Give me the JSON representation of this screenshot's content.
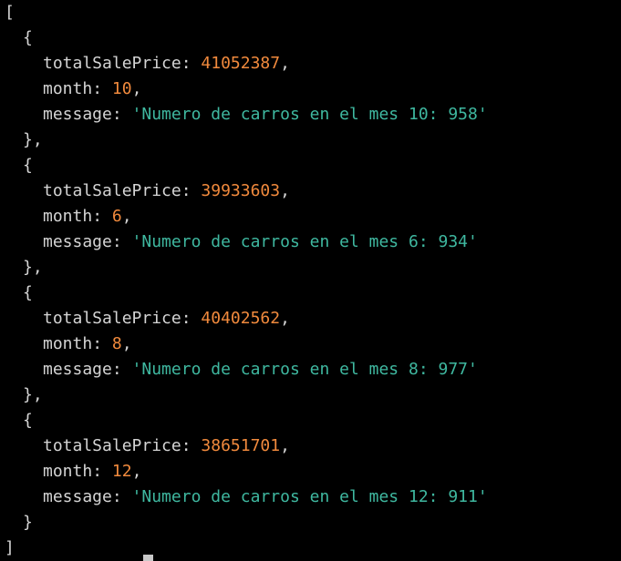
{
  "terminal": {
    "open_bracket": "[",
    "close_bracket": "]",
    "open_brace": "{",
    "close_brace_comma": "},",
    "close_brace": "}",
    "key_total": "totalSalePrice",
    "key_month": "month",
    "key_message": "message",
    "colon": ": ",
    "comma": ",",
    "entries": [
      {
        "totalSalePrice": "41052387",
        "month": "10",
        "message": "'Numero de carros en el mes 10: 958'"
      },
      {
        "totalSalePrice": "39933603",
        "month": "6",
        "message": "'Numero de carros en el mes 6: 934'"
      },
      {
        "totalSalePrice": "40402562",
        "month": "8",
        "message": "'Numero de carros en el mes 8: 977'"
      },
      {
        "totalSalePrice": "38651701",
        "month": "12",
        "message": "'Numero de carros en el mes 12: 911'"
      }
    ],
    "colors": {
      "background": "#000000",
      "text": "#d4d4d4",
      "number": "#f18a3d",
      "string": "#3fb8a0"
    }
  }
}
